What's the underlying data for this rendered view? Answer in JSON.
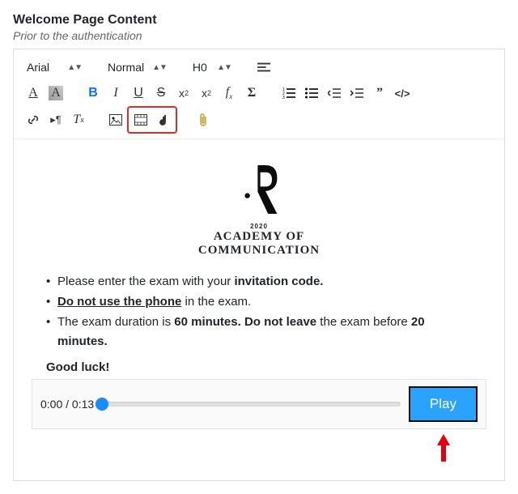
{
  "header": {
    "title": "Welcome Page Content",
    "subtitle": "Prior to the authentication"
  },
  "toolbar": {
    "font": "Arial",
    "size": "Normal",
    "heading": "H0"
  },
  "logo": {
    "year": "2020",
    "line1": "ACADEMY OF",
    "line2": "COMMUNICATION"
  },
  "bullets": {
    "b1_a": "Please enter the exam with your ",
    "b1_b": "invitation code.",
    "b2_a": "Do not use the phone",
    "b2_b": " in the exam.",
    "b3_a": "The exam duration is ",
    "b3_b": "60 minutes. Do not leave",
    "b3_c": " the exam before ",
    "b3_d": "20 minutes."
  },
  "good_luck": "Good luck!",
  "audio": {
    "time": "0:00 / 0:13",
    "play": "Play"
  }
}
